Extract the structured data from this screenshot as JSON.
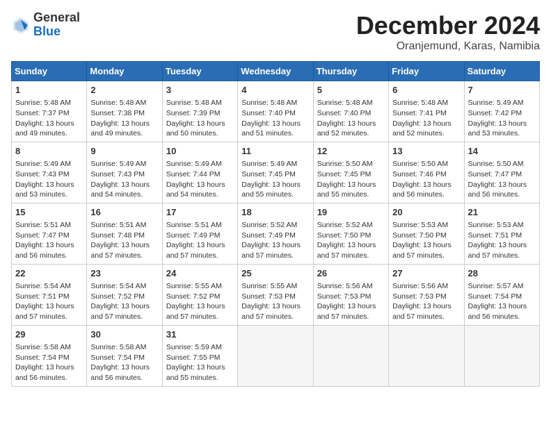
{
  "header": {
    "logo_general": "General",
    "logo_blue": "Blue",
    "month_title": "December 2024",
    "location": "Oranjemund, Karas, Namibia"
  },
  "calendar": {
    "days_of_week": [
      "Sunday",
      "Monday",
      "Tuesday",
      "Wednesday",
      "Thursday",
      "Friday",
      "Saturday"
    ],
    "weeks": [
      [
        {
          "day": "1",
          "info": "Sunrise: 5:48 AM\nSunset: 7:37 PM\nDaylight: 13 hours\nand 49 minutes."
        },
        {
          "day": "2",
          "info": "Sunrise: 5:48 AM\nSunset: 7:38 PM\nDaylight: 13 hours\nand 49 minutes."
        },
        {
          "day": "3",
          "info": "Sunrise: 5:48 AM\nSunset: 7:39 PM\nDaylight: 13 hours\nand 50 minutes."
        },
        {
          "day": "4",
          "info": "Sunrise: 5:48 AM\nSunset: 7:40 PM\nDaylight: 13 hours\nand 51 minutes."
        },
        {
          "day": "5",
          "info": "Sunrise: 5:48 AM\nSunset: 7:40 PM\nDaylight: 13 hours\nand 52 minutes."
        },
        {
          "day": "6",
          "info": "Sunrise: 5:48 AM\nSunset: 7:41 PM\nDaylight: 13 hours\nand 52 minutes."
        },
        {
          "day": "7",
          "info": "Sunrise: 5:49 AM\nSunset: 7:42 PM\nDaylight: 13 hours\nand 53 minutes."
        }
      ],
      [
        {
          "day": "8",
          "info": "Sunrise: 5:49 AM\nSunset: 7:43 PM\nDaylight: 13 hours\nand 53 minutes."
        },
        {
          "day": "9",
          "info": "Sunrise: 5:49 AM\nSunset: 7:43 PM\nDaylight: 13 hours\nand 54 minutes."
        },
        {
          "day": "10",
          "info": "Sunrise: 5:49 AM\nSunset: 7:44 PM\nDaylight: 13 hours\nand 54 minutes."
        },
        {
          "day": "11",
          "info": "Sunrise: 5:49 AM\nSunset: 7:45 PM\nDaylight: 13 hours\nand 55 minutes."
        },
        {
          "day": "12",
          "info": "Sunrise: 5:50 AM\nSunset: 7:45 PM\nDaylight: 13 hours\nand 55 minutes."
        },
        {
          "day": "13",
          "info": "Sunrise: 5:50 AM\nSunset: 7:46 PM\nDaylight: 13 hours\nand 56 minutes."
        },
        {
          "day": "14",
          "info": "Sunrise: 5:50 AM\nSunset: 7:47 PM\nDaylight: 13 hours\nand 56 minutes."
        }
      ],
      [
        {
          "day": "15",
          "info": "Sunrise: 5:51 AM\nSunset: 7:47 PM\nDaylight: 13 hours\nand 56 minutes."
        },
        {
          "day": "16",
          "info": "Sunrise: 5:51 AM\nSunset: 7:48 PM\nDaylight: 13 hours\nand 57 minutes."
        },
        {
          "day": "17",
          "info": "Sunrise: 5:51 AM\nSunset: 7:49 PM\nDaylight: 13 hours\nand 57 minutes."
        },
        {
          "day": "18",
          "info": "Sunrise: 5:52 AM\nSunset: 7:49 PM\nDaylight: 13 hours\nand 57 minutes."
        },
        {
          "day": "19",
          "info": "Sunrise: 5:52 AM\nSunset: 7:50 PM\nDaylight: 13 hours\nand 57 minutes."
        },
        {
          "day": "20",
          "info": "Sunrise: 5:53 AM\nSunset: 7:50 PM\nDaylight: 13 hours\nand 57 minutes."
        },
        {
          "day": "21",
          "info": "Sunrise: 5:53 AM\nSunset: 7:51 PM\nDaylight: 13 hours\nand 57 minutes."
        }
      ],
      [
        {
          "day": "22",
          "info": "Sunrise: 5:54 AM\nSunset: 7:51 PM\nDaylight: 13 hours\nand 57 minutes."
        },
        {
          "day": "23",
          "info": "Sunrise: 5:54 AM\nSunset: 7:52 PM\nDaylight: 13 hours\nand 57 minutes."
        },
        {
          "day": "24",
          "info": "Sunrise: 5:55 AM\nSunset: 7:52 PM\nDaylight: 13 hours\nand 57 minutes."
        },
        {
          "day": "25",
          "info": "Sunrise: 5:55 AM\nSunset: 7:53 PM\nDaylight: 13 hours\nand 57 minutes."
        },
        {
          "day": "26",
          "info": "Sunrise: 5:56 AM\nSunset: 7:53 PM\nDaylight: 13 hours\nand 57 minutes."
        },
        {
          "day": "27",
          "info": "Sunrise: 5:56 AM\nSunset: 7:53 PM\nDaylight: 13 hours\nand 57 minutes."
        },
        {
          "day": "28",
          "info": "Sunrise: 5:57 AM\nSunset: 7:54 PM\nDaylight: 13 hours\nand 56 minutes."
        }
      ],
      [
        {
          "day": "29",
          "info": "Sunrise: 5:58 AM\nSunset: 7:54 PM\nDaylight: 13 hours\nand 56 minutes."
        },
        {
          "day": "30",
          "info": "Sunrise: 5:58 AM\nSunset: 7:54 PM\nDaylight: 13 hours\nand 56 minutes."
        },
        {
          "day": "31",
          "info": "Sunrise: 5:59 AM\nSunset: 7:55 PM\nDaylight: 13 hours\nand 55 minutes."
        },
        {
          "day": "",
          "info": ""
        },
        {
          "day": "",
          "info": ""
        },
        {
          "day": "",
          "info": ""
        },
        {
          "day": "",
          "info": ""
        }
      ]
    ]
  }
}
